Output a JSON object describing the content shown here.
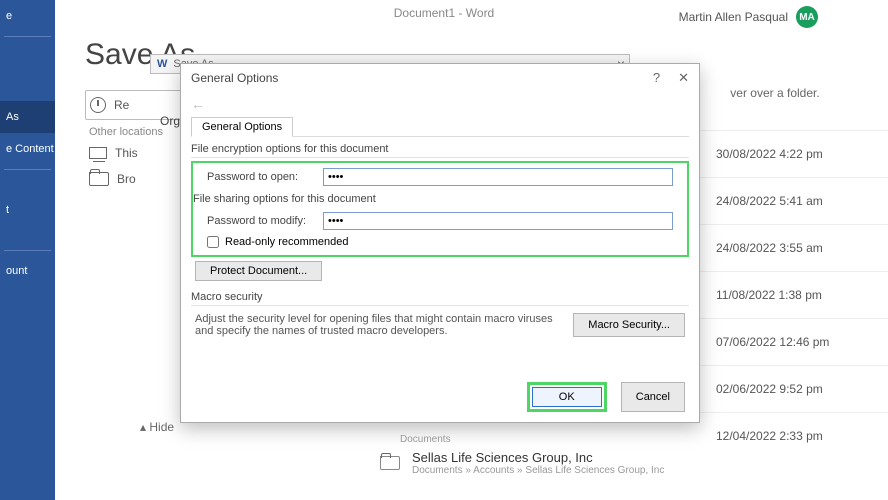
{
  "titlebar": {
    "doc": "Document1  -  Word",
    "user": "Martin Allen Pasqual",
    "initials": "MA"
  },
  "page": {
    "title": "Save As",
    "hide_pane": "▴ Hide"
  },
  "nav": {
    "items": [
      "e",
      "",
      "",
      "",
      "As",
      "e Content",
      "",
      "t",
      "",
      "ount",
      ""
    ],
    "active_index": 4
  },
  "save_left": {
    "recent": "Re",
    "other_locations": "Other locations",
    "this_pc": "This",
    "browse": "Bro",
    "organize": "Organ"
  },
  "save_as_dialog": {
    "title": "Save As"
  },
  "dialog": {
    "title": "General Options",
    "tab": "General Options",
    "encryption_label": "File encryption options for this document",
    "pwd_open_label": "Password to open:",
    "pwd_open_value": "••••",
    "sharing_label": "File sharing options for this document",
    "pwd_modify_label": "Password to modify:",
    "pwd_modify_value": "••••",
    "readonly_label": "Read-only recommended",
    "protect_btn": "Protect Document...",
    "macro_section": "Macro security",
    "macro_text": "Adjust the security level for opening files that might contain macro viruses and specify the names of trusted macro developers.",
    "macro_btn": "Macro Security...",
    "ok": "OK",
    "cancel": "Cancel"
  },
  "list": {
    "hint": "ver over a folder.",
    "timestamps": [
      "30/08/2022 4:22 pm",
      "24/08/2022 5:41 am",
      "24/08/2022 3:55 am",
      "11/08/2022 1:38 pm",
      "07/06/2022 12:46 pm",
      "02/06/2022 9:52 pm",
      "12/04/2022 2:33 pm"
    ]
  },
  "folder_row": {
    "above_label": "Documents",
    "name": "Sellas Life Sciences Group, Inc",
    "path": "Documents » Accounts » Sellas Life Sciences Group, Inc"
  }
}
